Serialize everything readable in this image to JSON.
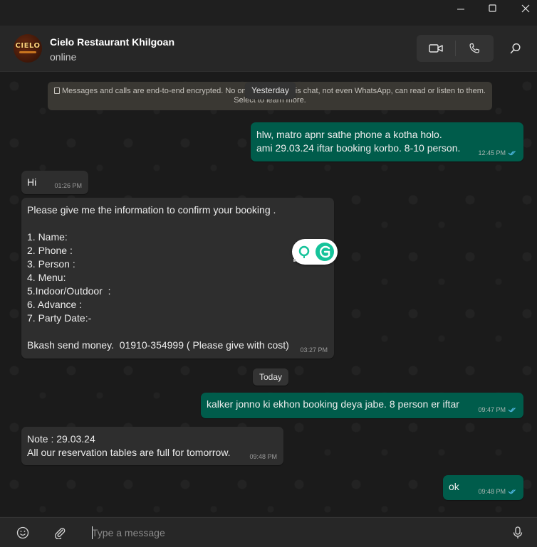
{
  "window": {
    "minimize_icon": "minimize-icon",
    "maximize_icon": "maximize-icon",
    "close_icon": "close-icon"
  },
  "header": {
    "avatar_text": "CIELO",
    "contact_name": "Cielo Restaurant Khilgoan",
    "status": "online",
    "video_call_icon": "video-camera-icon",
    "voice_call_icon": "phone-icon",
    "search_icon": "search-icon"
  },
  "chat": {
    "encryption_notice_line1": "Messages and calls are end-to-end encrypted. No one outside of this chat, not even WhatsApp, can read or listen to them.",
    "encryption_notice_line2": "Select to learn more.",
    "date_yesterday": "Yesterday",
    "date_today": "Today",
    "messages": [
      {
        "dir": "out",
        "text": "hlw, matro apnr sathe phone a kotha holo.\nami 29.03.24 iftar booking korbo. 8-10 person.",
        "time": "12:45 PM"
      },
      {
        "dir": "in",
        "text": "Hi",
        "time": "01:26 PM"
      },
      {
        "dir": "in",
        "text": "Please give me the information to confirm your booking .\n\n1. Name:\n2. Phone :\n3. Person :\n4. Menu:\n5.Indoor/Outdoor  :\n6. Advance :\n7. Party Date:-\n\nBkash send money.  01910-354999 ( Please give with cost)",
        "time": "03:27 PM"
      },
      {
        "dir": "out",
        "text": "kalker jonno ki ekhon booking deya jabe. 8 person er iftar",
        "time": "09:47 PM"
      },
      {
        "dir": "in",
        "text": "Note : 29.03.24\nAll our reservation tables are full for tomorrow.",
        "time": "09:48 PM"
      },
      {
        "dir": "out",
        "text": "ok",
        "time": "09:48 PM"
      }
    ],
    "read_receipt_color": "#53bdeb"
  },
  "composer": {
    "placeholder": "Type a message",
    "emoji_icon": "emoji-icon",
    "attach_icon": "paperclip-icon",
    "mic_icon": "microphone-icon"
  },
  "colors": {
    "outgoing_bubble": "#005c4b",
    "incoming_bubble": "#2e2e2e",
    "grammarly": "#15c39a"
  }
}
